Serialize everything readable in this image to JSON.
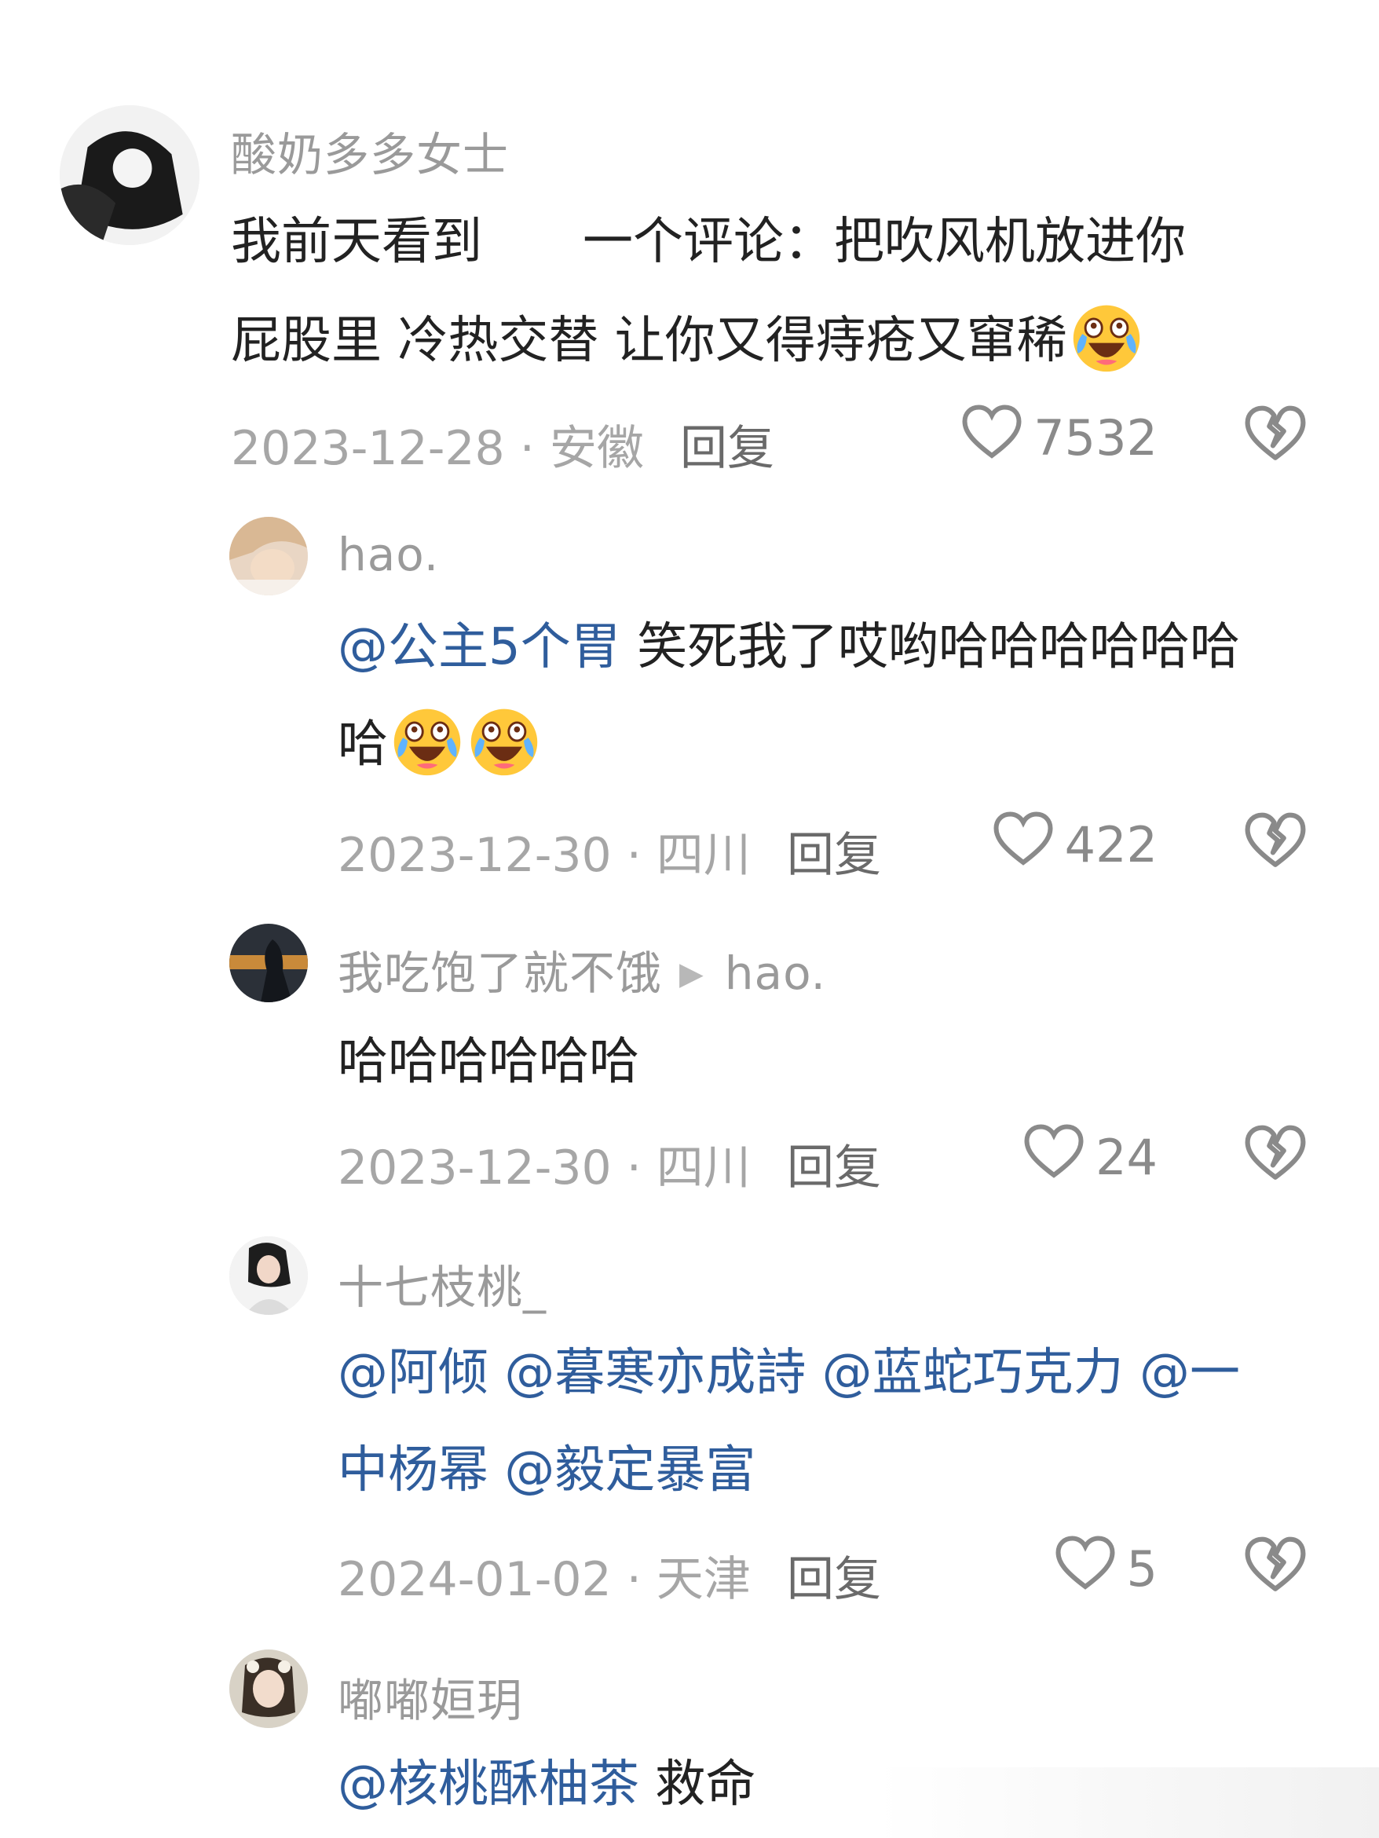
{
  "comments": [
    {
      "username": "酸奶多多女士",
      "text_line1": "我前天看到　　一个评论：把吹风机放进你",
      "text_line2": "屁股里 冷热交替 让你又得痔疮又窜稀",
      "emoji_after": "laugh-cry-emoji",
      "date_location": "2023-12-28 · 安徽",
      "reply_label": "回复",
      "likes": "7532"
    },
    {
      "username": "hao.",
      "mention": "@公主5个胃",
      "text_line1": " 笑死我了哎哟哈哈哈哈哈哈",
      "text_line2": "哈",
      "emoji_count": 2,
      "date_location": "2023-12-30 · 四川",
      "reply_label": "回复",
      "likes": "422"
    },
    {
      "username": "我吃饱了就不饿",
      "reply_to": "hao.",
      "text_line1": "哈哈哈哈哈哈",
      "date_location": "2023-12-30 · 四川",
      "reply_label": "回复",
      "likes": "24"
    },
    {
      "username": "十七枝桃_",
      "mention_line1": "@阿倾 @暮寒亦成詩 @蓝蛇巧克力 @一",
      "mention_line2": "中杨幂 @毅定暴富",
      "date_location": "2024-01-02 · 天津",
      "reply_label": "回复",
      "likes": "5"
    },
    {
      "username": "嘟嘟姮玥",
      "mention": "@核桃酥柚茶",
      "text_line1": " 救命"
    }
  ],
  "colors": {
    "mention": "#2f5d9c",
    "username": "#9a9a9a",
    "body": "#222222",
    "meta": "#a6a6a6"
  },
  "icons": [
    "heart-outline-icon",
    "broken-heart-icon",
    "play-triangle-icon",
    "laugh-cry-emoji"
  ]
}
